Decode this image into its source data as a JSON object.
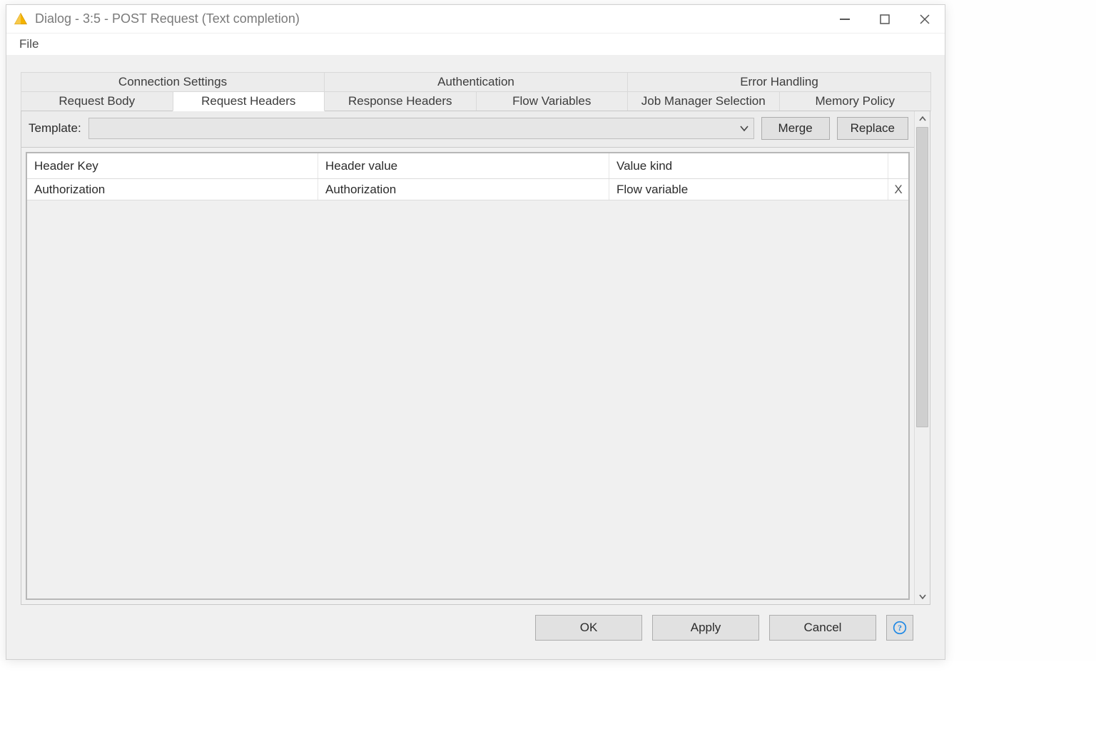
{
  "window": {
    "title": "Dialog - 3:5 - POST Request (Text completion)"
  },
  "menu": {
    "file": "File"
  },
  "tabs": {
    "row1": [
      {
        "label": "Connection Settings",
        "active": false
      },
      {
        "label": "Authentication",
        "active": false
      },
      {
        "label": "Error Handling",
        "active": false
      }
    ],
    "row2": [
      {
        "label": "Request Body",
        "active": false
      },
      {
        "label": "Request Headers",
        "active": true
      },
      {
        "label": "Response Headers",
        "active": false
      },
      {
        "label": "Flow Variables",
        "active": false
      },
      {
        "label": "Job Manager Selection",
        "active": false
      },
      {
        "label": "Memory Policy",
        "active": false
      }
    ]
  },
  "template": {
    "label": "Template:",
    "selected": "",
    "merge": "Merge",
    "replace": "Replace"
  },
  "headers_table": {
    "columns": {
      "key": "Header Key",
      "value": "Header value",
      "kind": "Value kind"
    },
    "rows": [
      {
        "key": "Authorization",
        "value": "Authorization",
        "kind": "Flow variable"
      }
    ],
    "delete_glyph": "X"
  },
  "footer": {
    "ok": "OK",
    "apply": "Apply",
    "cancel": "Cancel"
  }
}
